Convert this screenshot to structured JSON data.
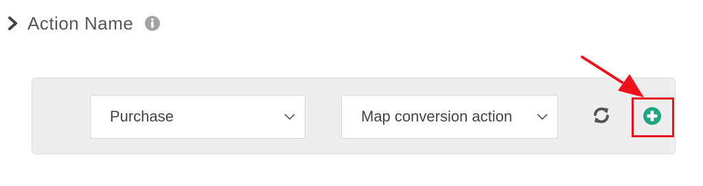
{
  "section": {
    "title": "Action Name"
  },
  "mapping_row": {
    "source_select": {
      "value": "Purchase"
    },
    "target_select": {
      "value": "Map conversion action"
    }
  },
  "icons": {
    "expand": "chevron-right-icon",
    "info": "info-circle-icon",
    "dropdown": "chevron-down-icon",
    "refresh": "refresh-icon",
    "add": "plus-circle-icon",
    "annotation": "arrow-annotation"
  },
  "colors": {
    "title_text": "#555555",
    "panel_bg": "#eeeeee",
    "add_green": "#1fa57f",
    "highlight_red": "#e8141e",
    "icon_gray": "#555555"
  }
}
